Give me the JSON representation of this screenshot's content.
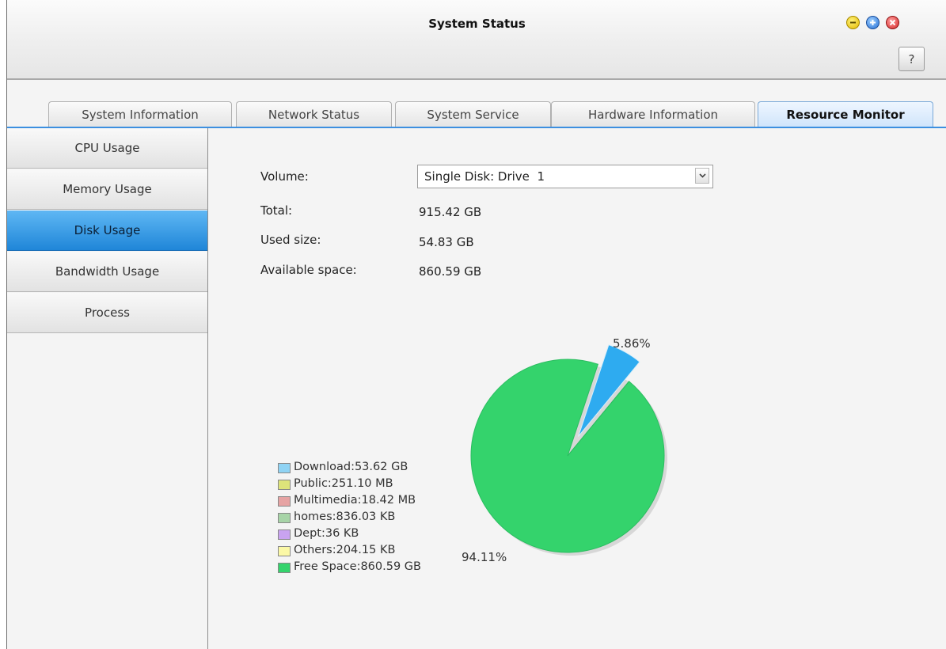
{
  "window": {
    "title": "System Status",
    "help_label": "?"
  },
  "tabs": [
    {
      "label": "System Information"
    },
    {
      "label": "Network Status"
    },
    {
      "label": "System Service"
    },
    {
      "label": "Hardware Information"
    },
    {
      "label": "Resource Monitor",
      "active": true
    }
  ],
  "sidebar": {
    "items": [
      {
        "label": "CPU Usage"
      },
      {
        "label": "Memory Usage"
      },
      {
        "label": "Disk Usage",
        "active": true
      },
      {
        "label": "Bandwidth Usage"
      },
      {
        "label": "Process"
      }
    ]
  },
  "disk": {
    "volume_label": "Volume:",
    "volume_value": "Single Disk: Drive  1",
    "total_label": "Total:",
    "total_value": "915.42 GB",
    "used_label": "Used size:",
    "used_value": "54.83 GB",
    "available_label": "Available space:",
    "available_value": "860.59 GB"
  },
  "chart_data": {
    "type": "pie",
    "slices": [
      {
        "label": "Download:53.62 GB",
        "share": 5.86,
        "color": "#8fd3f4"
      },
      {
        "label": "Public:251.10 MB",
        "share": 0.03,
        "color": "#dde37a"
      },
      {
        "label": "Multimedia:18.42 MB",
        "share": 0.0,
        "color": "#e6a3a3"
      },
      {
        "label": "homes:836.03 KB",
        "share": 0.0,
        "color": "#a7d4a7"
      },
      {
        "label": "Dept:36 KB",
        "share": 0.0,
        "color": "#c9a3f0"
      },
      {
        "label": "Others:204.15 KB",
        "share": 0.0,
        "color": "#fbf8a6"
      },
      {
        "label": "Free Space:860.59 GB",
        "share": 94.11,
        "color": "#34d36c"
      }
    ],
    "slice_labels": [
      "5.86%",
      "94.11%"
    ],
    "explode_color": "#2eabf0",
    "legend_position": "left"
  }
}
